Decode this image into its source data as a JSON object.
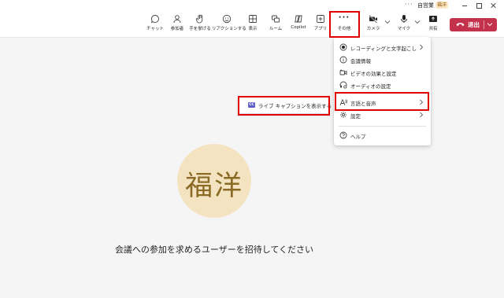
{
  "titlebar": {
    "more": "···",
    "org_name": "自営業",
    "badge": "福洋"
  },
  "toolbar": {
    "chat": "チャット",
    "people": "参加者",
    "raise_hand": "手を挙げる",
    "reactions": "リアクションする",
    "view": "表示",
    "rooms": "ルーム",
    "copilot": "Copilot",
    "apps": "アプリ",
    "more": "その他",
    "more_glyph": "···",
    "camera": "カメラ",
    "mic": "マイク",
    "share": "共有",
    "leave": "退出"
  },
  "more_menu": {
    "items": [
      {
        "label": "レコーディングと文字起こし",
        "icon": "record-icon",
        "has_submenu": true
      },
      {
        "label": "会議情報",
        "icon": "info-icon",
        "has_submenu": false
      },
      {
        "label": "ビデオの効果と設定",
        "icon": "video-effects-icon",
        "has_submenu": false
      },
      {
        "label": "オーディオの設定",
        "icon": "audio-settings-icon",
        "has_submenu": false
      },
      {
        "label": "言語と音声",
        "icon": "language-speech-icon",
        "has_submenu": true
      },
      {
        "label": "設定",
        "icon": "gear-icon",
        "has_submenu": true
      },
      {
        "label": "ヘルプ",
        "icon": "help-icon",
        "has_submenu": false
      }
    ]
  },
  "submenu": {
    "badge": "CC",
    "label": "ライブ キャプションを表示する"
  },
  "avatar": {
    "initials": "福洋"
  },
  "main": {
    "invite_text": "会議への参加を求めるユーザーを招待してください"
  },
  "colors": {
    "leave_button": "#c4314b",
    "highlight_box": "#e00000",
    "avatar_bg": "#f3e3c1",
    "avatar_text": "#8a6a25",
    "caption_badge": "#5b5fc7"
  }
}
